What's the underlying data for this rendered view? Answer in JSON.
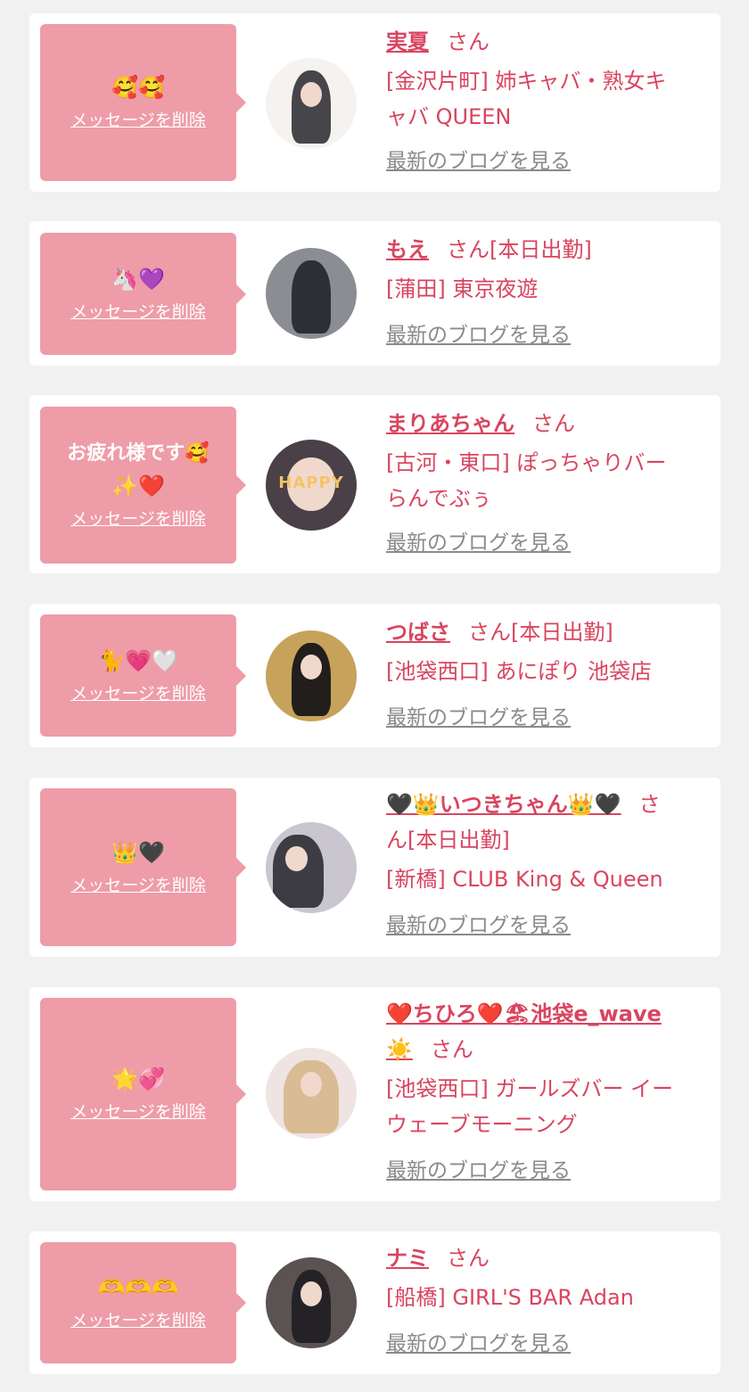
{
  "delete_label": "メッセージを削除",
  "blog_label": "最新のブログを見る",
  "honorific": "さん",
  "colors": {
    "page_bg": "#f1f1f1",
    "card_bg": "#ffffff",
    "bubble_bg": "#ef9ca9",
    "accent": "#d9455f",
    "muted_link": "#8a8a8a"
  },
  "entries": [
    {
      "message": "🥰🥰",
      "name": "実夏",
      "working_today": "",
      "shop_line1": "[金沢片町] 姉キャバ・熟女キ",
      "shop_line2": "ャバ QUEEN"
    },
    {
      "message": "🦄💜",
      "name": "もえ",
      "working_today": "[本日出勤]",
      "shop_line1": "[蒲田] 東京夜遊",
      "shop_line2": ""
    },
    {
      "message_line1": "お疲れ様です🥰",
      "message_line2": "✨❤️",
      "name": "まりあちゃん",
      "working_today": "",
      "shop_line1": "[古河・東口] ぽっちゃりバー",
      "shop_line2": "らんでぶぅ",
      "avatar_text": "HAPPY"
    },
    {
      "message": "🐈💗🤍",
      "name": "つばさ",
      "working_today": "[本日出勤]",
      "shop_line1": "[池袋西口] あにぽり 池袋店",
      "shop_line2": ""
    },
    {
      "message": "👑🖤",
      "name": "🖤👑いつきちゃん👑🖤",
      "san_line_wrap_1": "さ",
      "san_line_wrap_2": "ん[本日出勤]",
      "shop_line1": "[新橋] CLUB King & Queen",
      "shop_line2": ""
    },
    {
      "message": "🌟💞",
      "name_line1": "❤️ちひろ❤️🏖池袋e_wave",
      "name_line2": "☀️",
      "working_today": "",
      "shop_line1": "[池袋西口] ガールズバー イー",
      "shop_line2": "ウェーブモーニング"
    },
    {
      "message": "🫶🫶🫶",
      "name": "ナミ",
      "working_today": "",
      "shop_line1": "[船橋] GIRL'S BAR Adan",
      "shop_line2": ""
    }
  ]
}
